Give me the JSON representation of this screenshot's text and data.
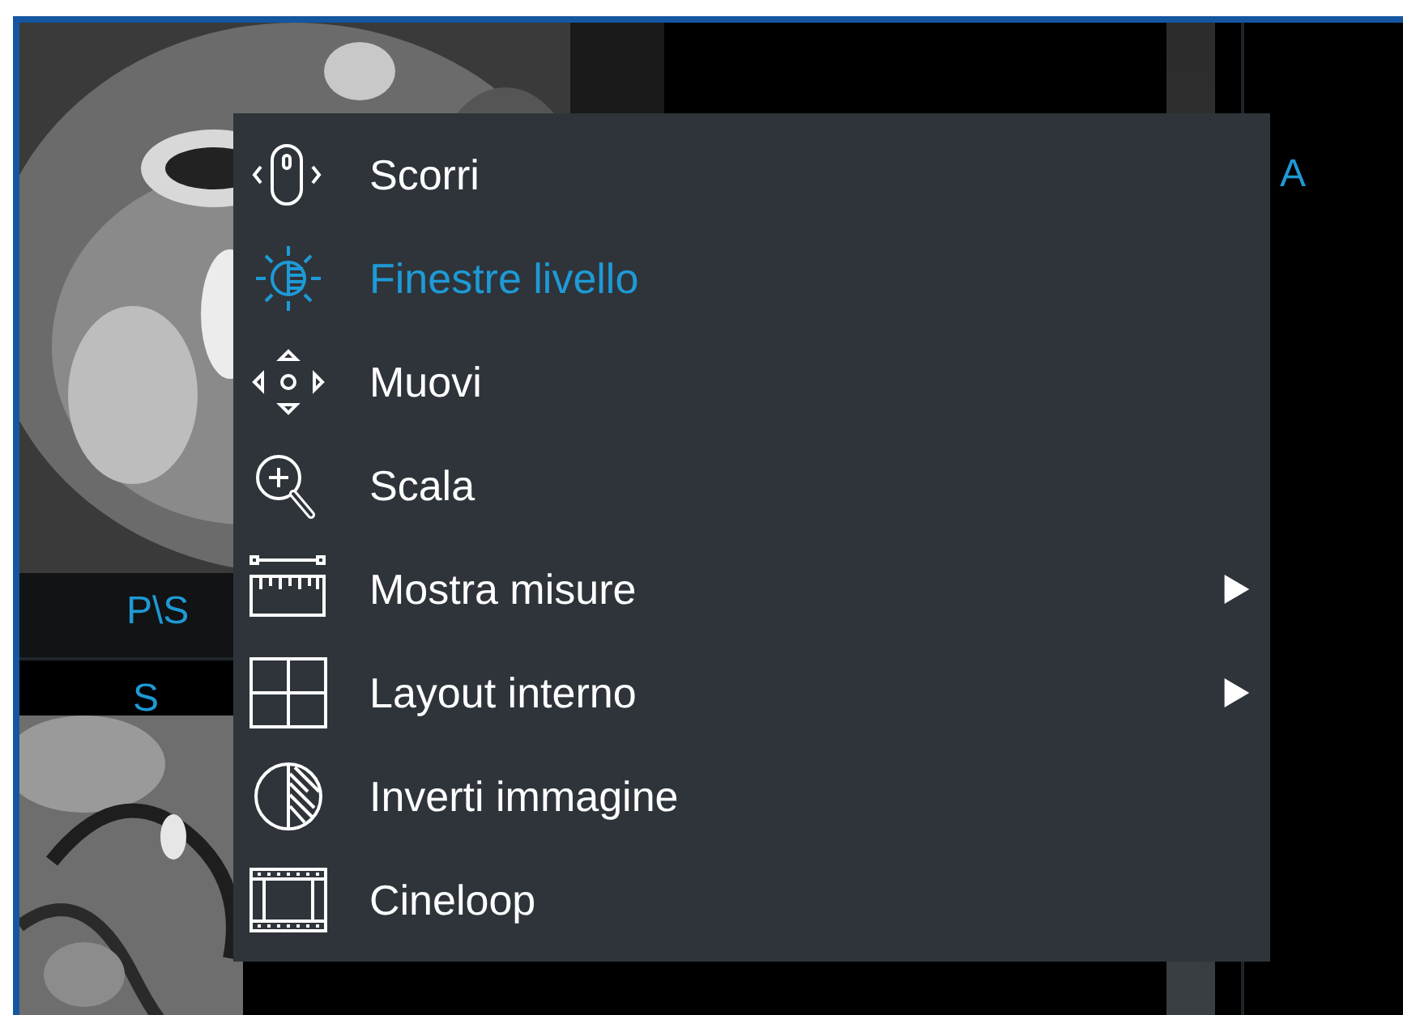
{
  "viewports": [
    {
      "label": "P\\S"
    },
    {
      "kind": "image_bottom",
      "label": "S"
    },
    {
      "kind": "empty",
      "label": "A"
    }
  ],
  "context_menu": {
    "items": [
      {
        "label": "Scorri",
        "kind": "mouse",
        "selected": false,
        "submenu": false
      },
      {
        "label": "Finestre livello",
        "kind": "brightness",
        "selected": true,
        "submenu": false
      },
      {
        "label": "Muovi",
        "kind": "move",
        "selected": false,
        "submenu": false
      },
      {
        "label": "Scala",
        "kind": "zoom",
        "selected": false,
        "submenu": false
      },
      {
        "label": "Mostra misure",
        "kind": "ruler",
        "selected": false,
        "submenu": true
      },
      {
        "label": "Layout interno",
        "kind": "grid",
        "selected": false,
        "submenu": true
      },
      {
        "label": "Inverti immagine",
        "kind": "contrast",
        "selected": false,
        "submenu": false
      },
      {
        "label": "Cineloop",
        "kind": "film",
        "selected": false,
        "submenu": false
      }
    ]
  }
}
